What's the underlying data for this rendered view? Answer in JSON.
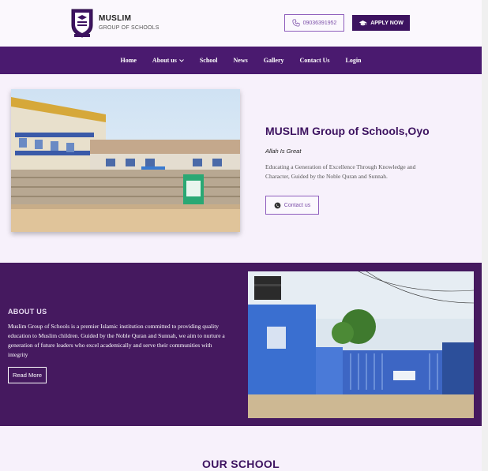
{
  "header": {
    "brand_name": "MUSLIM",
    "brand_sub": "GROUP OF SCHOOLS",
    "phone": "09036391952",
    "apply_label": "APPLY NOW"
  },
  "nav": {
    "items": [
      "Home",
      "About us",
      "School",
      "News",
      "Gallery",
      "Contact Us",
      "Login"
    ]
  },
  "hero": {
    "title": "MUSLIM Group of Schools,Oyo",
    "motto": "Allah Is Great",
    "description": "Educating a Generation of Excellence Through Knowledge and Character, Guided by the Noble Quran and Sunnah.",
    "contact_label": "Contact us"
  },
  "about": {
    "title": "ABOUT US",
    "text": "Muslim Group of Schools is a premier Islamic institution committed to providing quality education to Muslim children. Guided by the Noble Quran and Sunnah, we aim to nurture a generation of future leaders who excel academically and serve their communities with integrity",
    "read_more": "Read More"
  },
  "our_school": {
    "title": "OUR SCHOOL"
  },
  "colors": {
    "primary": "#4a1a6f",
    "accent": "#8e5dbc",
    "background": "#f7f1fb"
  }
}
